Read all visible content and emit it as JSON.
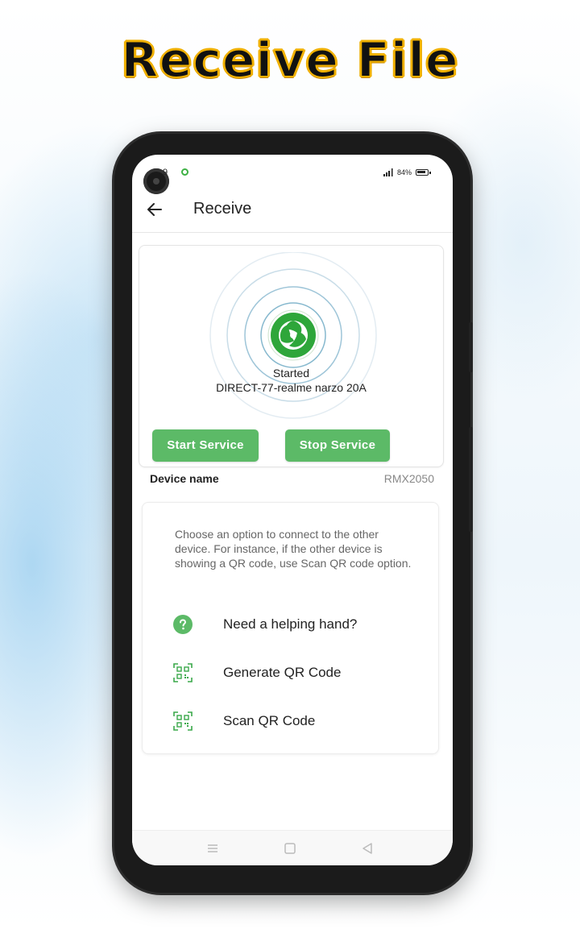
{
  "headline": "Receive File",
  "status_bar": {
    "time": "9",
    "battery": "84%"
  },
  "app_bar": {
    "title": "Receive",
    "back_icon": "arrow-left-icon"
  },
  "service_card": {
    "logo_icon": "share-logo-icon",
    "status": "Started",
    "device_ssid": "DIRECT-77-realme narzo 20A",
    "start_button": "Start Service",
    "stop_button": "Stop Service"
  },
  "device_name": {
    "label": "Device name",
    "value": "RMX2050"
  },
  "options_card": {
    "help_text": "Choose an option to connect to the other device. For instance, if the other device is showing a QR code, use Scan QR code option.",
    "options": [
      {
        "label": "Need a helping hand?",
        "icon": "help-circle-icon"
      },
      {
        "label": "Generate QR Code",
        "icon": "qr-code-icon"
      },
      {
        "label": "Scan QR Code",
        "icon": "qr-scan-icon"
      }
    ]
  },
  "nav_bar": {
    "items": [
      "menu-icon",
      "home-icon",
      "back-triangle-icon"
    ]
  },
  "colors": {
    "accent": "#5cba67",
    "logo_green": "#2ea63a",
    "headline_outline": "#f0b000"
  }
}
